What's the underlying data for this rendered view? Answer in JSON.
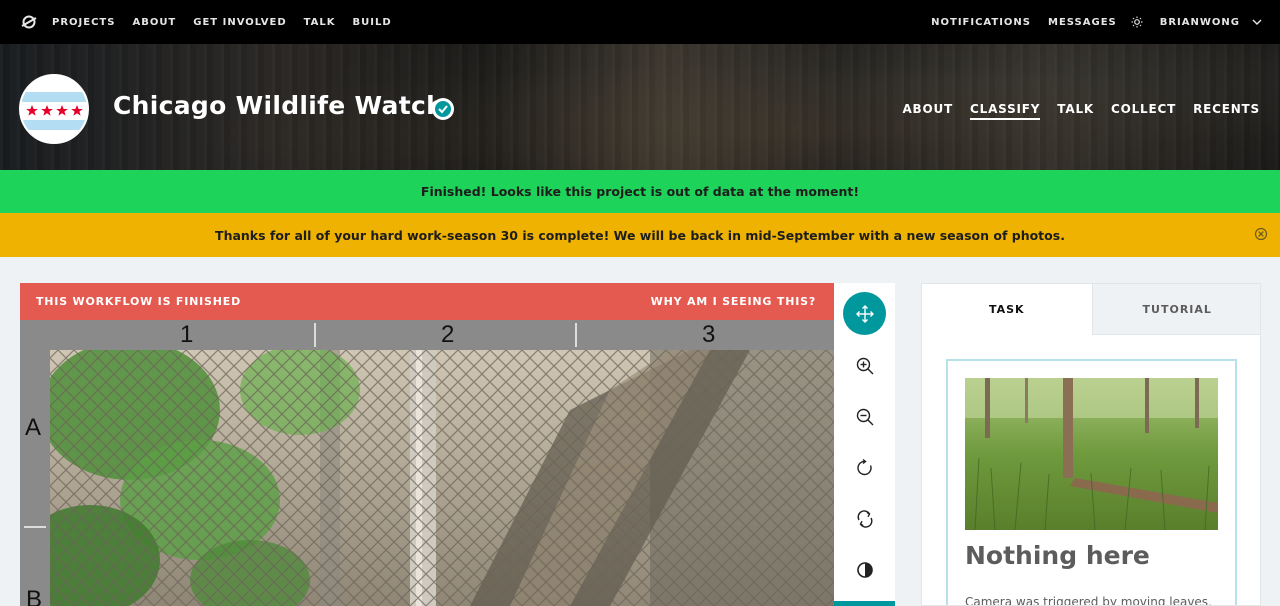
{
  "topnav": {
    "links": [
      "PROJECTS",
      "ABOUT",
      "GET INVOLVED",
      "TALK",
      "BUILD"
    ],
    "notifications": "NOTIFICATIONS",
    "messages": "MESSAGES",
    "username": "BRIANWONG",
    "icons": [
      "zooniverse-logo-icon",
      "sun-icon",
      "chevron-down-icon"
    ]
  },
  "project": {
    "title": "Chicago Wildlife Watch",
    "verified_icon": "checkmark-icon",
    "nav": [
      "ABOUT",
      "CLASSIFY",
      "TALK",
      "COLLECT",
      "RECENTS"
    ],
    "active_nav": "CLASSIFY"
  },
  "banners": {
    "finished": "Finished! Looks like this project is out of data at the moment!",
    "season": "Thanks for all of your hard work-season 30 is complete! We will be back in mid-September with a new season of photos.",
    "colors": {
      "green": "#1ed359",
      "yellow": "#f0b200"
    }
  },
  "viewer": {
    "workflow_finished": "THIS WORKFLOW IS FINISHED",
    "why": "WHY AM I SEEING THIS?",
    "grid_columns": [
      "1",
      "2",
      "3"
    ],
    "grid_rows": [
      "A",
      "B"
    ],
    "bar_color": "#e45950"
  },
  "toolbar": {
    "tools": [
      "move-icon",
      "zoom-in-icon",
      "zoom-out-icon",
      "rotate-icon",
      "reset-icon",
      "invert-icon"
    ],
    "accent": "#00979d"
  },
  "task": {
    "tabs": [
      "TASK",
      "TUTORIAL"
    ],
    "active_tab": "TASK",
    "card_heading": "Nothing here",
    "card_desc": "Camera was triggered by moving leaves,"
  }
}
